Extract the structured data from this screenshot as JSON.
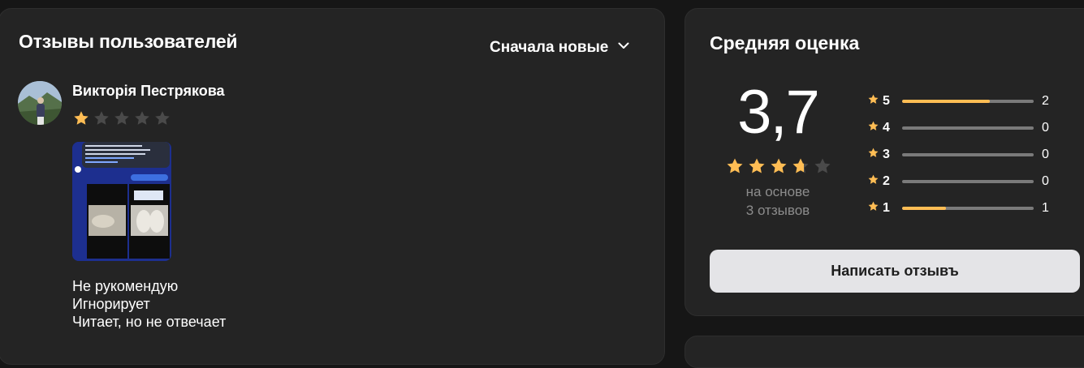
{
  "reviews": {
    "title": "Отзывы пользователей",
    "sort_label": "Сначала новые",
    "sort_icon": "chevron-down-icon",
    "items": [
      {
        "author": "Викторія Пестрякова",
        "rating": 1,
        "max_rating": 5,
        "text_lines": [
          "Не рукомендую",
          "Игнорирует",
          "Читает, но не отвечает"
        ]
      }
    ]
  },
  "rating_summary": {
    "title": "Средняя оценка",
    "average": "3,7",
    "average_value": 3.7,
    "basis_line1": "на основе",
    "basis_line2": "3 отзывов",
    "distribution": [
      {
        "stars": "5",
        "count": "2",
        "fraction": 0.667
      },
      {
        "stars": "4",
        "count": "0",
        "fraction": 0
      },
      {
        "stars": "3",
        "count": "0",
        "fraction": 0
      },
      {
        "stars": "2",
        "count": "0",
        "fraction": 0
      },
      {
        "stars": "1",
        "count": "1",
        "fraction": 0.333
      }
    ],
    "write_button": "Написать отзывъ"
  },
  "colors": {
    "star_filled": "#ffbd54",
    "star_empty": "#4a4a4a",
    "card_bg": "#242424",
    "page_bg": "#161616"
  }
}
